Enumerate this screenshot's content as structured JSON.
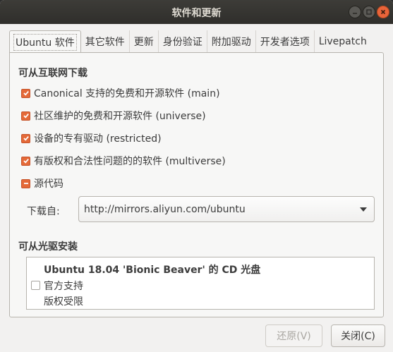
{
  "window": {
    "title": "软件和更新"
  },
  "tabs": [
    {
      "label": "Ubuntu 软件",
      "active": true
    },
    {
      "label": "其它软件",
      "active": false
    },
    {
      "label": "更新",
      "active": false
    },
    {
      "label": "身份验证",
      "active": false
    },
    {
      "label": "附加驱动",
      "active": false
    },
    {
      "label": "开发者选项",
      "active": false
    },
    {
      "label": "Livepatch",
      "active": false
    }
  ],
  "internet": {
    "heading": "可从互联网下载",
    "options": [
      {
        "label": "Canonical 支持的免费和开源软件 (main)",
        "state": "checked"
      },
      {
        "label": "社区维护的免费和开源软件 (universe)",
        "state": "checked"
      },
      {
        "label": "设备的专有驱动 (restricted)",
        "state": "checked"
      },
      {
        "label": "有版权和合法性问题的的软件 (multiverse)",
        "state": "checked"
      },
      {
        "label": "源代码",
        "state": "mixed"
      }
    ],
    "download_from_label": "下载自:",
    "download_server": "http://mirrors.aliyun.com/ubuntu"
  },
  "cdrom": {
    "heading": "可从光驱安装",
    "item_title": "Ubuntu 18.04 'Bionic Beaver' 的 CD 光盘",
    "item_line2": "官方支持",
    "item_line3": "版权受限",
    "checked": false
  },
  "buttons": {
    "revert": "还原(V)",
    "close": "关闭(C)"
  },
  "colors": {
    "accent": "#e46938",
    "titlebar": "#3d3c38",
    "background": "#f2f1f0"
  }
}
